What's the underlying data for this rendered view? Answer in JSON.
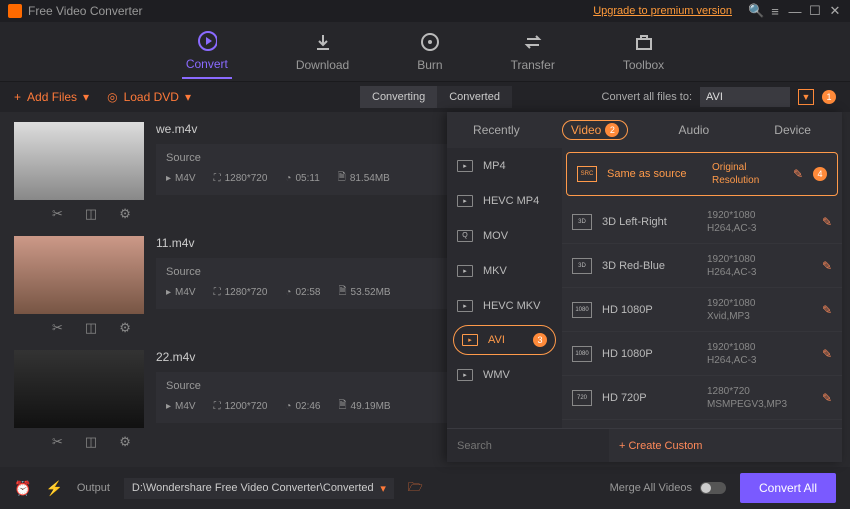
{
  "title": "Free Video Converter",
  "upgrade_link": "Upgrade to premium version",
  "main_tabs": {
    "convert": "Convert",
    "download": "Download",
    "burn": "Burn",
    "transfer": "Transfer",
    "toolbox": "Toolbox"
  },
  "toolbar": {
    "add_files": "Add Files",
    "load_dvd": "Load DVD",
    "converting": "Converting",
    "converted": "Converted",
    "convert_all_label": "Convert all files to:",
    "combo_value": "AVI"
  },
  "badges": {
    "b1": "1",
    "b2": "2",
    "b3": "3",
    "b4": "4"
  },
  "files": [
    {
      "name": "we.m4v",
      "source": "Source",
      "fmt": "M4V",
      "res": "1280*720",
      "dur": "05:11",
      "size": "81.54MB"
    },
    {
      "name": "11.m4v",
      "source": "Source",
      "fmt": "M4V",
      "res": "1280*720",
      "dur": "02:58",
      "size": "53.52MB"
    },
    {
      "name": "22.m4v",
      "source": "Source",
      "fmt": "M4V",
      "res": "1200*720",
      "dur": "02:46",
      "size": "49.19MB"
    }
  ],
  "panel_tabs": {
    "recently": "Recently",
    "video": "Video",
    "audio": "Audio",
    "device": "Device"
  },
  "formats": [
    "MP4",
    "HEVC MP4",
    "MOV",
    "MKV",
    "HEVC MKV",
    "AVI",
    "WMV"
  ],
  "presets": [
    {
      "name": "Same as source",
      "d1": "Original Resolution",
      "d2": ""
    },
    {
      "name": "3D Left-Right",
      "d1": "1920*1080",
      "d2": "H264,AC-3"
    },
    {
      "name": "3D Red-Blue",
      "d1": "1920*1080",
      "d2": "H264,AC-3"
    },
    {
      "name": "HD 1080P",
      "d1": "1920*1080",
      "d2": "Xvid,MP3"
    },
    {
      "name": "HD 1080P",
      "d1": "1920*1080",
      "d2": "H264,AC-3"
    },
    {
      "name": "HD 720P",
      "d1": "1280*720",
      "d2": "MSMPEGV3,MP3"
    }
  ],
  "search_placeholder": "Search",
  "create_custom": "Create Custom",
  "bottom": {
    "output_label": "Output",
    "output_path": "D:\\Wondershare Free Video Converter\\Converted",
    "merge_label": "Merge All Videos",
    "convert_all": "Convert All"
  }
}
